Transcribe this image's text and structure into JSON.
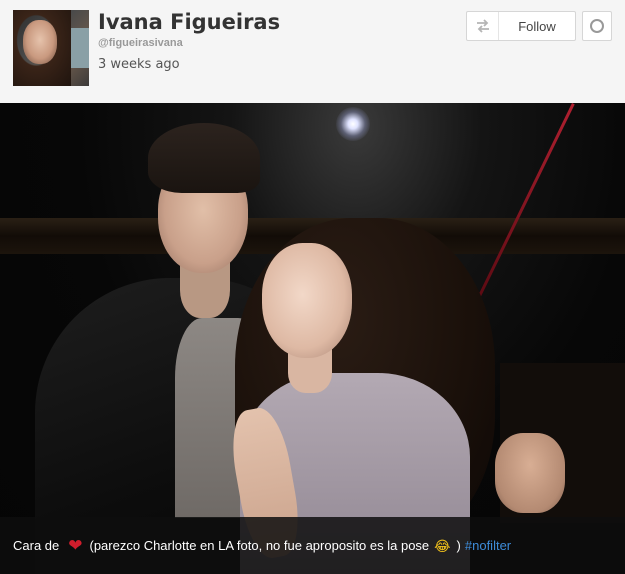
{
  "profile": {
    "name": "Ivana Figueiras",
    "handle": "@figueirasivana",
    "time_ago": "3 weeks ago",
    "avatar_icon": "profile-avatar"
  },
  "actions": {
    "follow_label": "Follow",
    "follow_icon": "swap-arrows-icon",
    "more_icon": "circle-icon"
  },
  "post": {
    "image_alt_icon": "photo",
    "caption": {
      "prefix": "Cara de",
      "heart": "❤",
      "middle": "(parezco Charlotte en LA foto, no fue aproposito es la pose",
      "emoji": "😂",
      "close": ")",
      "hashtag": "#nofilter"
    }
  },
  "colors": {
    "header_bg": "#f5f5f5",
    "hashtag": "#3d8bd8",
    "heart": "#d11d2c"
  }
}
